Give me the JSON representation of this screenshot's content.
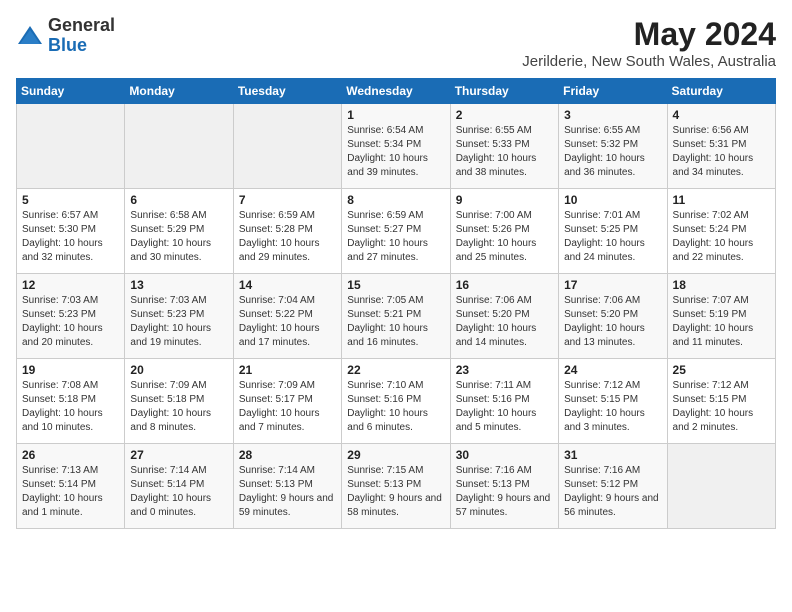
{
  "logo": {
    "general": "General",
    "blue": "Blue"
  },
  "title": "May 2024",
  "subtitle": "Jerilderie, New South Wales, Australia",
  "days_header": [
    "Sunday",
    "Monday",
    "Tuesday",
    "Wednesday",
    "Thursday",
    "Friday",
    "Saturday"
  ],
  "weeks": [
    [
      {
        "day": "",
        "sunrise": "",
        "sunset": "",
        "daylight": ""
      },
      {
        "day": "",
        "sunrise": "",
        "sunset": "",
        "daylight": ""
      },
      {
        "day": "",
        "sunrise": "",
        "sunset": "",
        "daylight": ""
      },
      {
        "day": "1",
        "sunrise": "Sunrise: 6:54 AM",
        "sunset": "Sunset: 5:34 PM",
        "daylight": "Daylight: 10 hours and 39 minutes."
      },
      {
        "day": "2",
        "sunrise": "Sunrise: 6:55 AM",
        "sunset": "Sunset: 5:33 PM",
        "daylight": "Daylight: 10 hours and 38 minutes."
      },
      {
        "day": "3",
        "sunrise": "Sunrise: 6:55 AM",
        "sunset": "Sunset: 5:32 PM",
        "daylight": "Daylight: 10 hours and 36 minutes."
      },
      {
        "day": "4",
        "sunrise": "Sunrise: 6:56 AM",
        "sunset": "Sunset: 5:31 PM",
        "daylight": "Daylight: 10 hours and 34 minutes."
      }
    ],
    [
      {
        "day": "5",
        "sunrise": "Sunrise: 6:57 AM",
        "sunset": "Sunset: 5:30 PM",
        "daylight": "Daylight: 10 hours and 32 minutes."
      },
      {
        "day": "6",
        "sunrise": "Sunrise: 6:58 AM",
        "sunset": "Sunset: 5:29 PM",
        "daylight": "Daylight: 10 hours and 30 minutes."
      },
      {
        "day": "7",
        "sunrise": "Sunrise: 6:59 AM",
        "sunset": "Sunset: 5:28 PM",
        "daylight": "Daylight: 10 hours and 29 minutes."
      },
      {
        "day": "8",
        "sunrise": "Sunrise: 6:59 AM",
        "sunset": "Sunset: 5:27 PM",
        "daylight": "Daylight: 10 hours and 27 minutes."
      },
      {
        "day": "9",
        "sunrise": "Sunrise: 7:00 AM",
        "sunset": "Sunset: 5:26 PM",
        "daylight": "Daylight: 10 hours and 25 minutes."
      },
      {
        "day": "10",
        "sunrise": "Sunrise: 7:01 AM",
        "sunset": "Sunset: 5:25 PM",
        "daylight": "Daylight: 10 hours and 24 minutes."
      },
      {
        "day": "11",
        "sunrise": "Sunrise: 7:02 AM",
        "sunset": "Sunset: 5:24 PM",
        "daylight": "Daylight: 10 hours and 22 minutes."
      }
    ],
    [
      {
        "day": "12",
        "sunrise": "Sunrise: 7:03 AM",
        "sunset": "Sunset: 5:23 PM",
        "daylight": "Daylight: 10 hours and 20 minutes."
      },
      {
        "day": "13",
        "sunrise": "Sunrise: 7:03 AM",
        "sunset": "Sunset: 5:23 PM",
        "daylight": "Daylight: 10 hours and 19 minutes."
      },
      {
        "day": "14",
        "sunrise": "Sunrise: 7:04 AM",
        "sunset": "Sunset: 5:22 PM",
        "daylight": "Daylight: 10 hours and 17 minutes."
      },
      {
        "day": "15",
        "sunrise": "Sunrise: 7:05 AM",
        "sunset": "Sunset: 5:21 PM",
        "daylight": "Daylight: 10 hours and 16 minutes."
      },
      {
        "day": "16",
        "sunrise": "Sunrise: 7:06 AM",
        "sunset": "Sunset: 5:20 PM",
        "daylight": "Daylight: 10 hours and 14 minutes."
      },
      {
        "day": "17",
        "sunrise": "Sunrise: 7:06 AM",
        "sunset": "Sunset: 5:20 PM",
        "daylight": "Daylight: 10 hours and 13 minutes."
      },
      {
        "day": "18",
        "sunrise": "Sunrise: 7:07 AM",
        "sunset": "Sunset: 5:19 PM",
        "daylight": "Daylight: 10 hours and 11 minutes."
      }
    ],
    [
      {
        "day": "19",
        "sunrise": "Sunrise: 7:08 AM",
        "sunset": "Sunset: 5:18 PM",
        "daylight": "Daylight: 10 hours and 10 minutes."
      },
      {
        "day": "20",
        "sunrise": "Sunrise: 7:09 AM",
        "sunset": "Sunset: 5:18 PM",
        "daylight": "Daylight: 10 hours and 8 minutes."
      },
      {
        "day": "21",
        "sunrise": "Sunrise: 7:09 AM",
        "sunset": "Sunset: 5:17 PM",
        "daylight": "Daylight: 10 hours and 7 minutes."
      },
      {
        "day": "22",
        "sunrise": "Sunrise: 7:10 AM",
        "sunset": "Sunset: 5:16 PM",
        "daylight": "Daylight: 10 hours and 6 minutes."
      },
      {
        "day": "23",
        "sunrise": "Sunrise: 7:11 AM",
        "sunset": "Sunset: 5:16 PM",
        "daylight": "Daylight: 10 hours and 5 minutes."
      },
      {
        "day": "24",
        "sunrise": "Sunrise: 7:12 AM",
        "sunset": "Sunset: 5:15 PM",
        "daylight": "Daylight: 10 hours and 3 minutes."
      },
      {
        "day": "25",
        "sunrise": "Sunrise: 7:12 AM",
        "sunset": "Sunset: 5:15 PM",
        "daylight": "Daylight: 10 hours and 2 minutes."
      }
    ],
    [
      {
        "day": "26",
        "sunrise": "Sunrise: 7:13 AM",
        "sunset": "Sunset: 5:14 PM",
        "daylight": "Daylight: 10 hours and 1 minute."
      },
      {
        "day": "27",
        "sunrise": "Sunrise: 7:14 AM",
        "sunset": "Sunset: 5:14 PM",
        "daylight": "Daylight: 10 hours and 0 minutes."
      },
      {
        "day": "28",
        "sunrise": "Sunrise: 7:14 AM",
        "sunset": "Sunset: 5:13 PM",
        "daylight": "Daylight: 9 hours and 59 minutes."
      },
      {
        "day": "29",
        "sunrise": "Sunrise: 7:15 AM",
        "sunset": "Sunset: 5:13 PM",
        "daylight": "Daylight: 9 hours and 58 minutes."
      },
      {
        "day": "30",
        "sunrise": "Sunrise: 7:16 AM",
        "sunset": "Sunset: 5:13 PM",
        "daylight": "Daylight: 9 hours and 57 minutes."
      },
      {
        "day": "31",
        "sunrise": "Sunrise: 7:16 AM",
        "sunset": "Sunset: 5:12 PM",
        "daylight": "Daylight: 9 hours and 56 minutes."
      },
      {
        "day": "",
        "sunrise": "",
        "sunset": "",
        "daylight": ""
      }
    ]
  ]
}
